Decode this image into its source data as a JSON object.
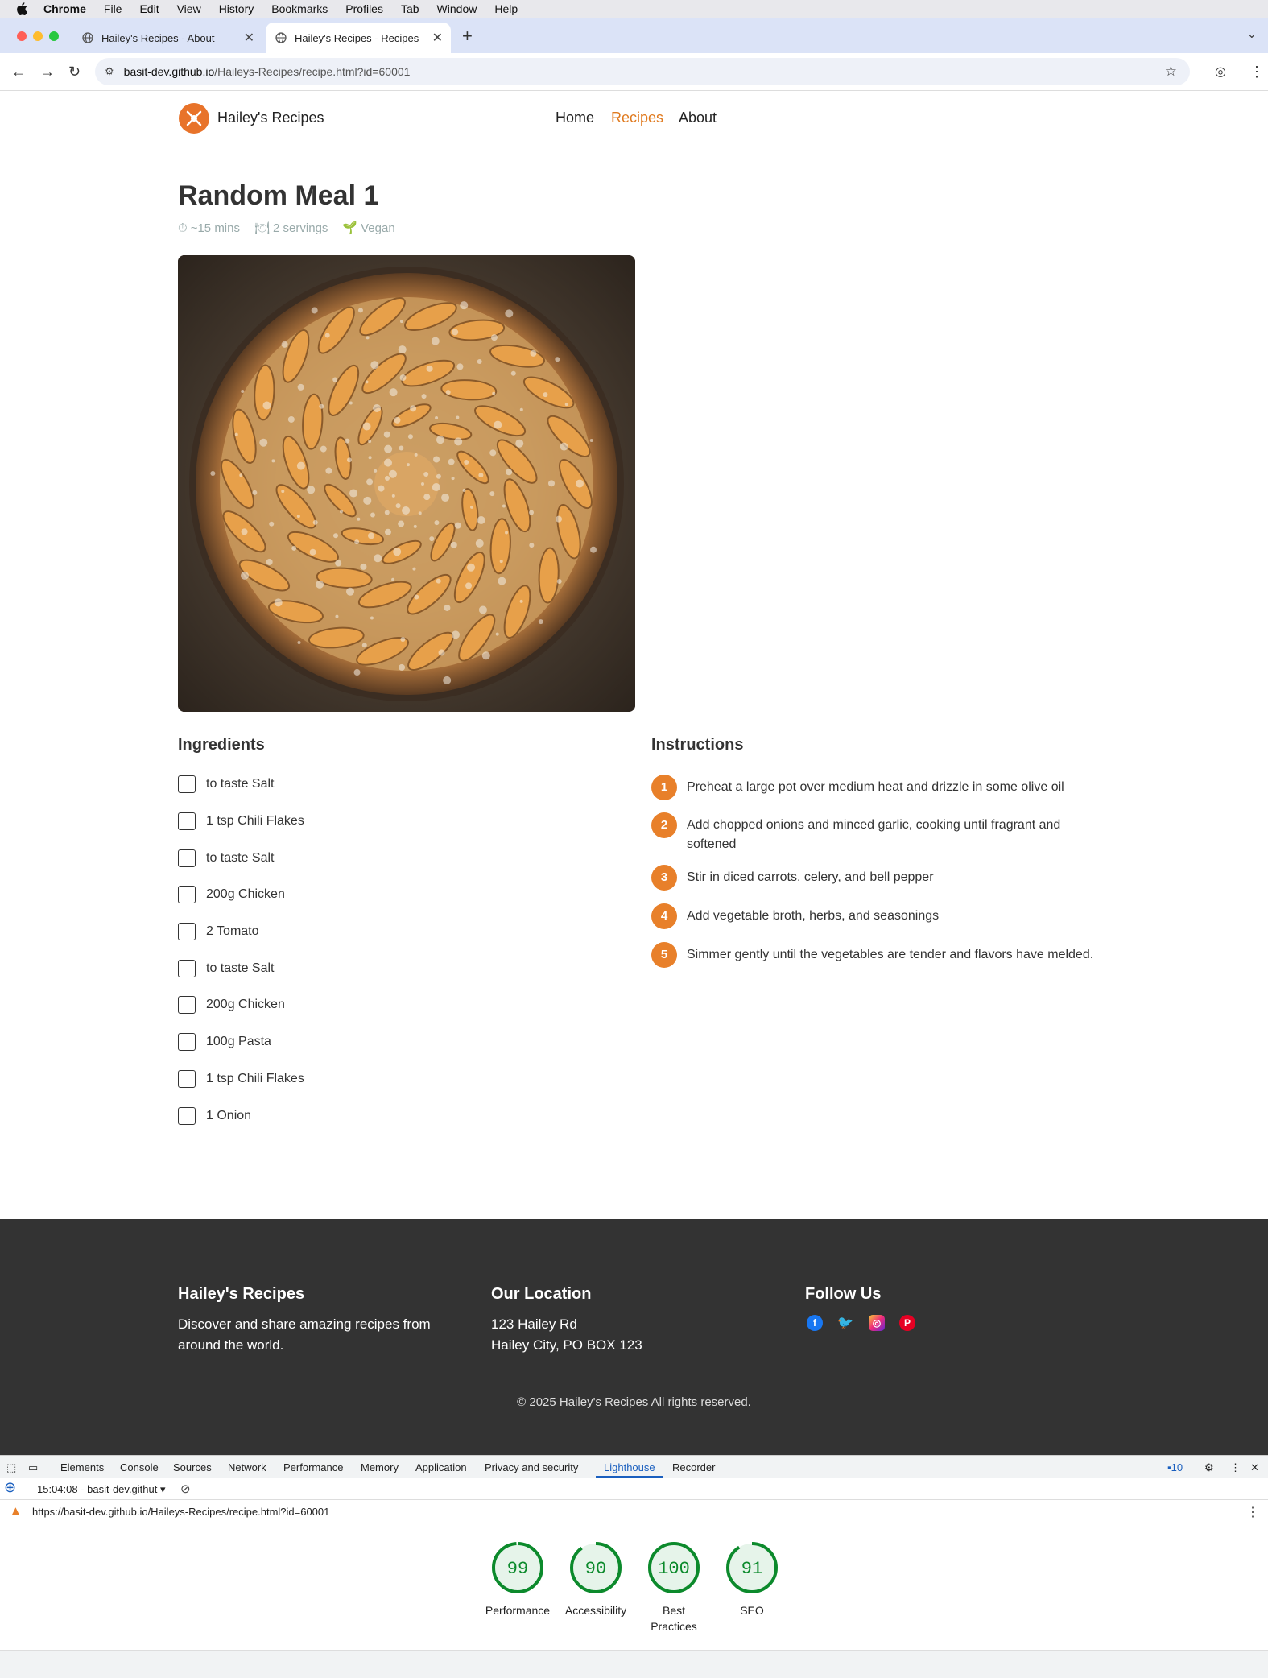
{
  "os_menu": {
    "app": "Chrome",
    "items": [
      "File",
      "Edit",
      "View",
      "History",
      "Bookmarks",
      "Profiles",
      "Tab",
      "Window",
      "Help"
    ]
  },
  "browser": {
    "tabs": [
      {
        "title": "Hailey's Recipes - About"
      },
      {
        "title": "Hailey's Recipes - Recipes"
      }
    ],
    "url_host": "basit-dev.github.io",
    "url_path": "/Haileys-Recipes/recipe.html?id=60001"
  },
  "site": {
    "name": "Hailey's Recipes",
    "nav": [
      "Home",
      "Recipes",
      "About"
    ]
  },
  "recipe": {
    "title": "Random Meal 1",
    "time": "~15 mins",
    "servings": "2 servings",
    "diet": "Vegan",
    "ingredients_heading": "Ingredients",
    "instructions_heading": "Instructions",
    "ingredients": [
      "to taste Salt",
      "1 tsp Chili Flakes",
      "to taste Salt",
      "200g Chicken",
      "2 Tomato",
      "to taste Salt",
      "200g Chicken",
      "100g Pasta",
      "1 tsp Chili Flakes",
      "1 Onion"
    ],
    "instructions": [
      {
        "n": "1",
        "text": "Preheat a large pot over medium heat and drizzle in some olive oil"
      },
      {
        "n": "2",
        "text": "Add chopped onions and minced garlic, cooking until fragrant and softened"
      },
      {
        "n": "3",
        "text": "Stir in diced carrots, celery, and bell pepper"
      },
      {
        "n": "4",
        "text": "Add vegetable broth, herbs, and seasonings"
      },
      {
        "n": "5",
        "text": "Simmer gently until the vegetables are tender and flavors have melded."
      }
    ]
  },
  "footer": {
    "brand_heading": "Hailey's Recipes",
    "brand_text": "Discover and share amazing recipes from around the world.",
    "location_heading": "Our Location",
    "address_line1": "123 Hailey Rd",
    "address_line2": "Hailey City, PO BOX 123",
    "follow_heading": "Follow Us",
    "social": [
      "facebook-icon",
      "twitter-icon",
      "instagram-icon",
      "pinterest-icon"
    ],
    "copyright": "© 2025 Hailey's Recipes All rights reserved."
  },
  "devtools": {
    "tabs": [
      "Elements",
      "Console",
      "Sources",
      "Network",
      "Performance",
      "Memory",
      "Application",
      "Privacy and security",
      "Lighthouse",
      "Recorder"
    ],
    "active_tab": "Lighthouse",
    "issues_count": "10",
    "report_label": "15:04:08 - basit-dev.githut",
    "report_url": "https://basit-dev.github.io/Haileys-Recipes/recipe.html?id=60001",
    "scores": [
      {
        "label": "Performance",
        "value": 99
      },
      {
        "label": "Accessibility",
        "value": 90
      },
      {
        "label": "Best Practices",
        "value": 100
      },
      {
        "label": "SEO",
        "value": 91
      }
    ]
  },
  "colors": {
    "accent": "#e8802a",
    "footer_bg": "#333333",
    "score_green": "#0c8a2c"
  }
}
